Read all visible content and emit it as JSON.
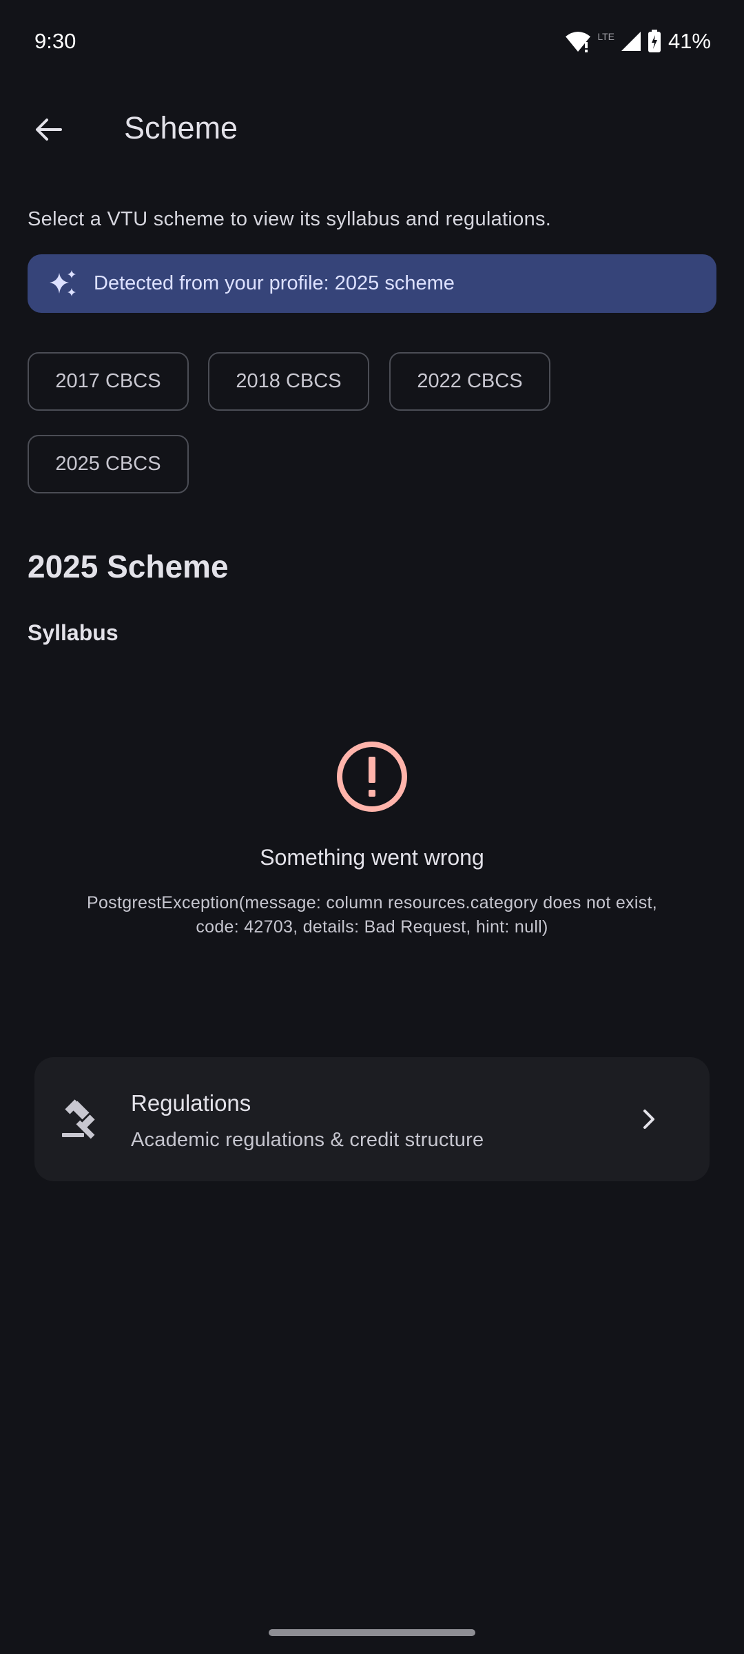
{
  "status_bar": {
    "time": "9:30",
    "battery_percent": "41%",
    "network_label": "LTE"
  },
  "app_bar": {
    "title": "Scheme"
  },
  "intro": {
    "text": "Select a VTU scheme to view its syllabus and regulations."
  },
  "banner": {
    "text": "Detected from your profile: 2025 scheme"
  },
  "schemes": [
    {
      "label": "2017 CBCS"
    },
    {
      "label": "2018 CBCS"
    },
    {
      "label": "2022 CBCS"
    },
    {
      "label": "2025 CBCS"
    }
  ],
  "section": {
    "title": "2025 Scheme",
    "syllabus_label": "Syllabus"
  },
  "error": {
    "title": "Something went wrong",
    "detail": "PostgrestException(message: column resources.category does not exist, code: 42703, details: Bad Request, hint: null)"
  },
  "regulations": {
    "title": "Regulations",
    "subtitle": "Academic regulations & credit structure"
  },
  "colors": {
    "background": "#121318",
    "banner": "#364479",
    "error_accent": "#ffb4ab",
    "card": "#1c1d22"
  }
}
